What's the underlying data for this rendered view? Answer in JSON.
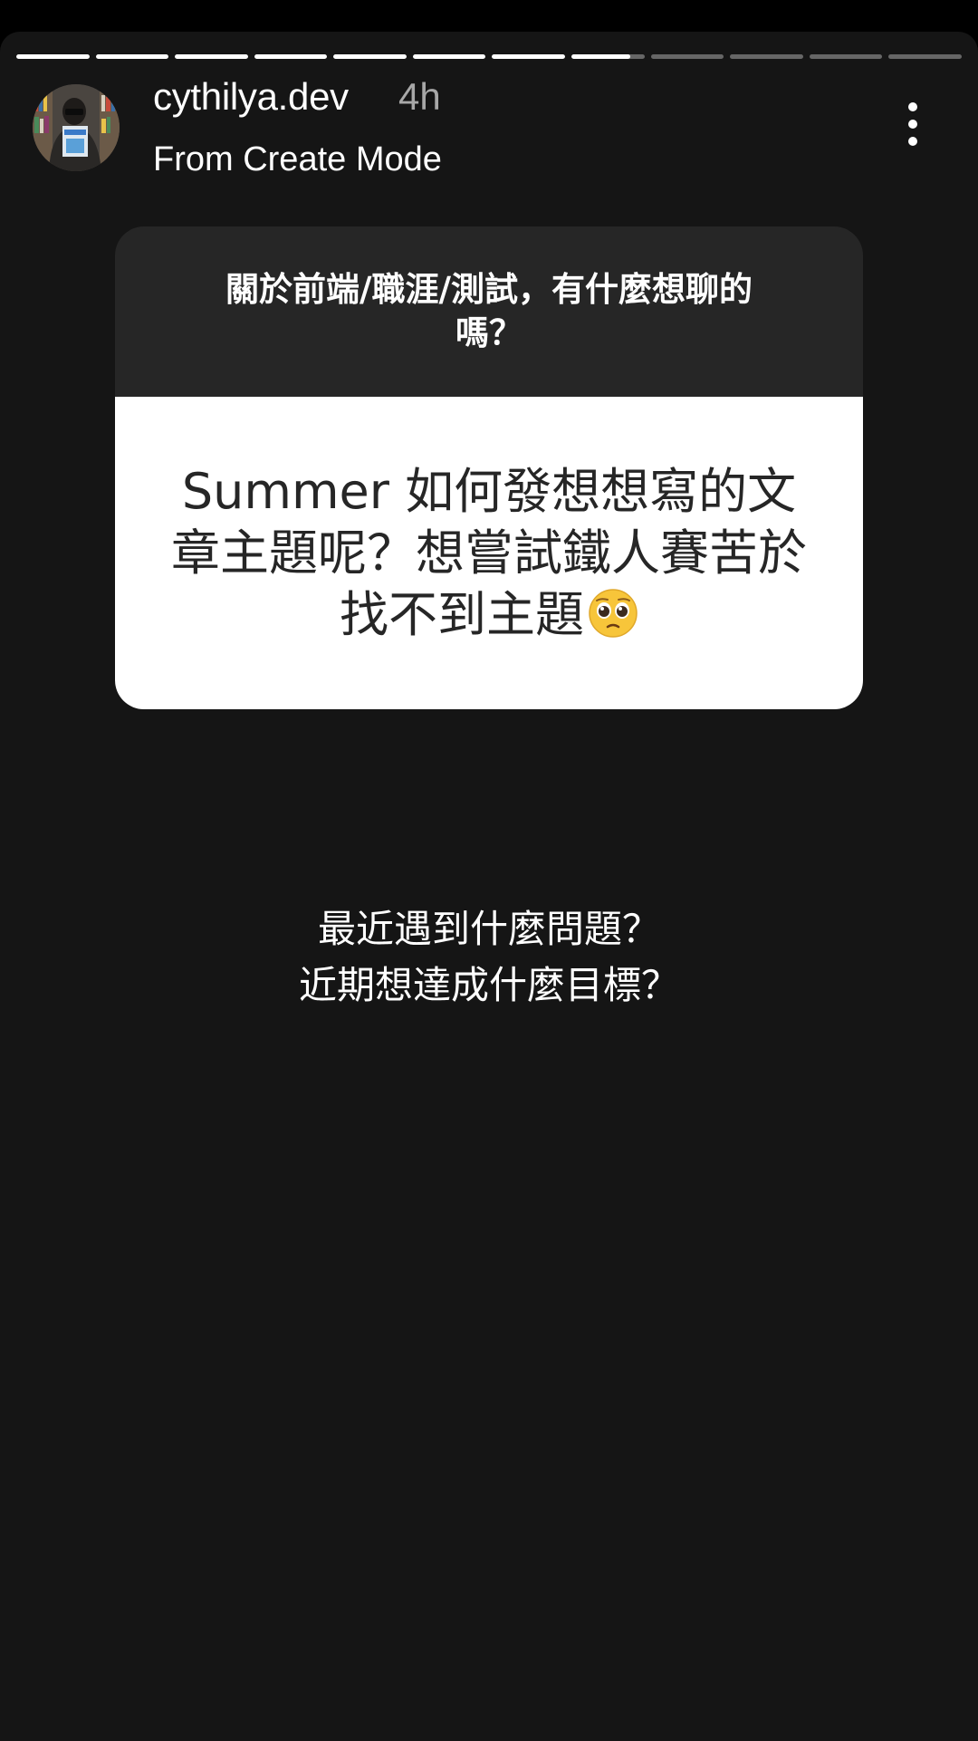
{
  "header": {
    "username": "cythilya.dev",
    "time": "4h",
    "subtitle": "From Create Mode",
    "more_icon": "more-vertical-icon"
  },
  "progress": {
    "total_segments": 12,
    "completed_segments": 7,
    "current_segment_fraction": 0.8
  },
  "question_card": {
    "prompt": "關於前端/職涯/測試，有什麼想聊的嗎？",
    "answer": "Summer 如何發想想寫的文章主題呢？想嘗試鐵人賽苦於找不到主題",
    "emoji": "pleading-face-emoji"
  },
  "caption": {
    "line1": "最近遇到什麼問題？",
    "line2": "近期想達成什麼目標？"
  },
  "colors": {
    "background": "#151515",
    "card_header": "#262626",
    "card_body": "#ffffff",
    "text_primary": "#ffffff",
    "text_muted": "#a8a8a8"
  }
}
